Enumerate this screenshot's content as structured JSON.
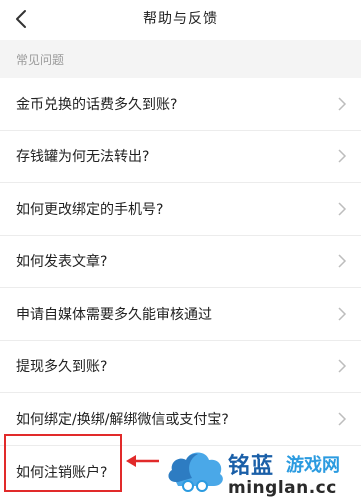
{
  "header": {
    "title": "帮助与反馈",
    "back_icon": "back-arrow-icon"
  },
  "section": {
    "title": "常见问题"
  },
  "faq": [
    "金币兑换的话费多久到账?",
    "存钱罐为何无法转出?",
    "如何更改绑定的手机号?",
    "如何发表文章?",
    "申请自媒体需要多久能审核通过",
    "提现多久到账?",
    "如何绑定/换绑/解绑微信或支付宝?",
    "如何注销账户?"
  ],
  "annotation": {
    "highlight_color": "#e12a2a",
    "highlighted_item": "如何注销账户?"
  },
  "watermark": {
    "brand_cn": "铭蓝",
    "brand_cn2": "游戏网",
    "brand_url": "minglan.cc",
    "colors": {
      "primary": "#1a5fa8",
      "secondary": "#2b9be0"
    }
  }
}
